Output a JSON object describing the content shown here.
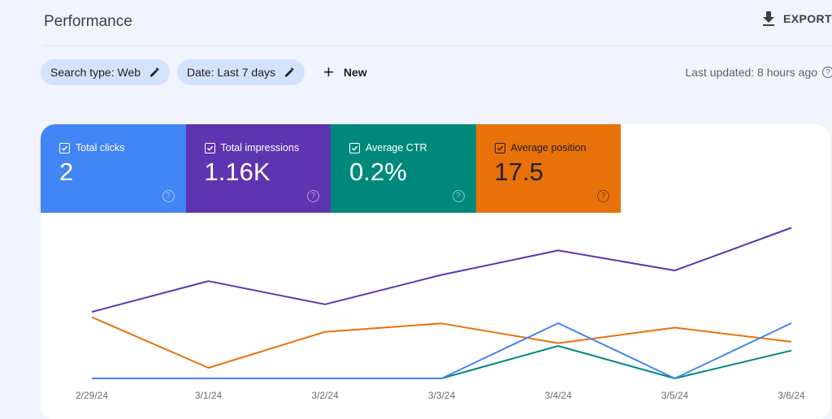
{
  "header": {
    "title": "Performance",
    "export_label": "EXPORT",
    "export_icon": "download-icon"
  },
  "filters": {
    "chips": [
      {
        "label": "Search type: Web",
        "icon": "edit-pencil-icon"
      },
      {
        "label": "Date: Last 7 days",
        "icon": "edit-pencil-icon"
      }
    ],
    "new_label": "New",
    "new_icon": "plus-icon"
  },
  "status": {
    "last_updated": "Last updated: 8 hours ago",
    "info_icon": "info-icon"
  },
  "metrics": [
    {
      "label": "Total clicks",
      "value": "2",
      "checked": true,
      "color": "#4285f4"
    },
    {
      "label": "Total impressions",
      "value": "1.16K",
      "checked": true,
      "color": "#5e35b1"
    },
    {
      "label": "Average CTR",
      "value": "0.2%",
      "checked": true,
      "color": "#00897b"
    },
    {
      "label": "Average position",
      "value": "17.5",
      "checked": true,
      "color": "#e8710a"
    }
  ],
  "chart_data": {
    "type": "line",
    "title": "",
    "xlabel": "",
    "ylabel": "",
    "grid": false,
    "legend": "none (metric tiles above act as legend)",
    "note": "Each series uses its own hidden y-axis; values are estimated from line positions. Position axis is inverted (lower = better, drawn higher).",
    "x": [
      "2/29/24",
      "3/1/24",
      "3/2/24",
      "3/3/24",
      "3/4/24",
      "3/5/24",
      "3/6/24"
    ],
    "series": [
      {
        "name": "Total clicks",
        "color": "#4285f4",
        "values": [
          0,
          0,
          0,
          0,
          1,
          0,
          1
        ],
        "ylim": [
          0,
          3
        ]
      },
      {
        "name": "Total impressions",
        "color": "#5e35b1",
        "values": [
          106,
          155,
          118,
          165,
          204,
          172,
          240
        ],
        "ylim": [
          0,
          264
        ]
      },
      {
        "name": "Average CTR",
        "color": "#00897b",
        "values": [
          0,
          0,
          0,
          0,
          0.49,
          0,
          0.42
        ],
        "ylim": [
          0,
          2.5
        ]
      },
      {
        "name": "Average position",
        "color": "#e8710a",
        "values": [
          14.8,
          22.0,
          16.9,
          15.7,
          18.5,
          16.3,
          18.3
        ],
        "ylim": [
          0,
          23.5
        ],
        "inverted": true
      }
    ]
  }
}
